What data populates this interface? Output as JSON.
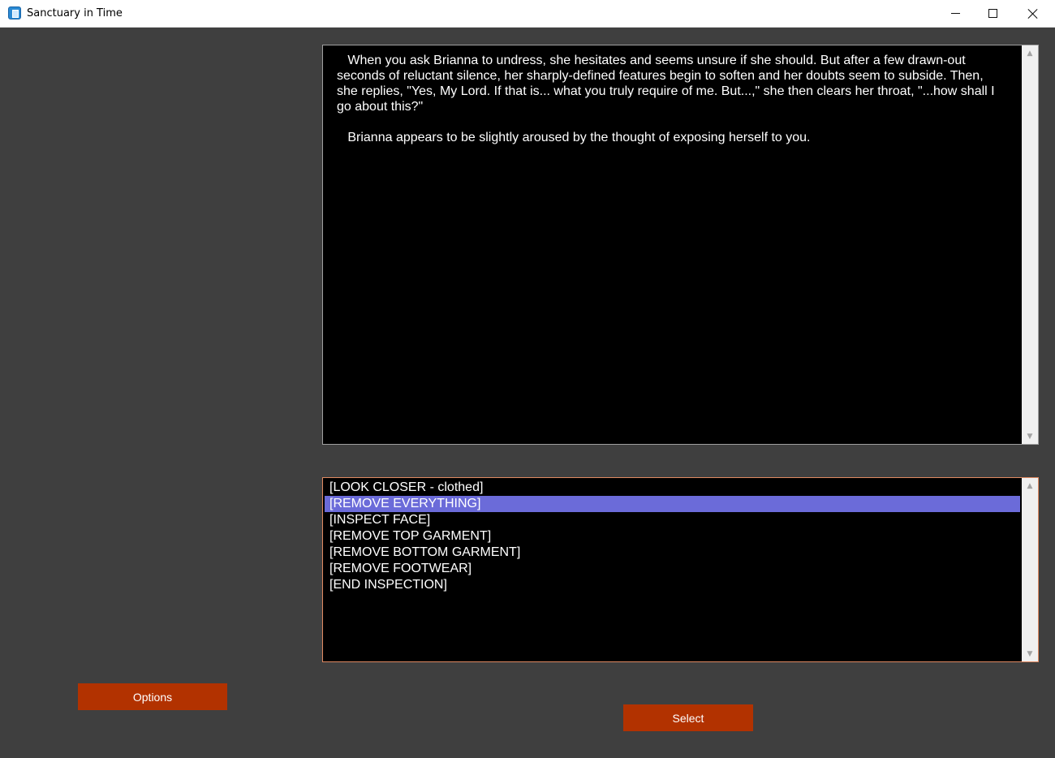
{
  "window": {
    "title": "Sanctuary in Time",
    "app_icon": "app-icon",
    "controls": {
      "minimize": "minimize-icon",
      "maximize": "maximize-icon",
      "close": "close-icon"
    }
  },
  "story": {
    "text": "   When you ask Brianna to undress, she hesitates and seems unsure if she should. But after a few drawn-out seconds of reluctant silence, her sharply-defined features begin to soften and her doubts seem to subside. Then, she replies, \"Yes, My Lord. If that is... what you truly require of me. But...,\" she then clears her throat, \"...how shall I go about this?\"\n\n   Brianna appears to be slightly aroused by the thought of exposing herself to you."
  },
  "choices": {
    "items": [
      "[LOOK CLOSER - clothed]",
      "[REMOVE EVERYTHING]",
      "[INSPECT FACE]",
      "[REMOVE TOP GARMENT]",
      "[REMOVE BOTTOM GARMENT]",
      "[REMOVE FOOTWEAR]",
      "[END INSPECTION]"
    ],
    "selected_index": 1
  },
  "buttons": {
    "options_label": "Options",
    "select_label": "Select"
  },
  "colors": {
    "background": "#3f3f3f",
    "panel": "#000000",
    "accent_button": "#b23200",
    "selection": "#6b6bd9",
    "list_border": "#e08a62"
  }
}
